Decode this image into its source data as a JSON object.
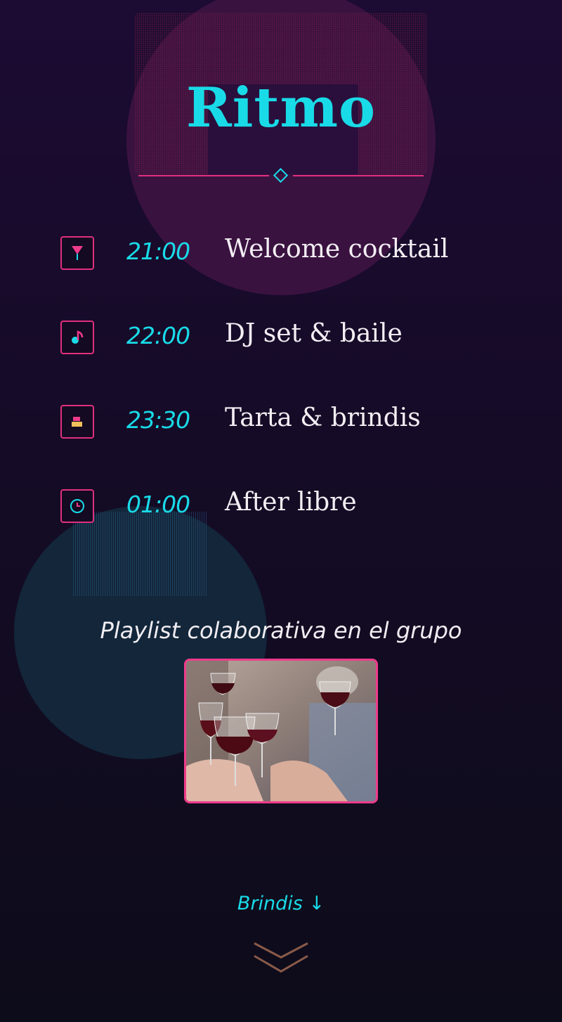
{
  "header": {
    "title": "Ritmo"
  },
  "schedule": [
    {
      "icon": "cocktail-icon",
      "time": "21:00",
      "event": "Welcome cocktail"
    },
    {
      "icon": "music-note-icon",
      "time": "22:00",
      "event": "DJ set & baile"
    },
    {
      "icon": "cake-icon",
      "time": "23:30",
      "event": "Tarta & brindis"
    },
    {
      "icon": "clock-icon",
      "time": "01:00",
      "event": "After libre"
    }
  ],
  "playlist": {
    "text": "Playlist colaborativa en el grupo"
  },
  "photo": {
    "subject": "wine-glasses-toast"
  },
  "footer": {
    "next_label": "Brindis ↓"
  },
  "colors": {
    "accent": "#19dbe8",
    "pink": "#e0307e",
    "text": "#f3eef3",
    "background": "#150b26"
  }
}
